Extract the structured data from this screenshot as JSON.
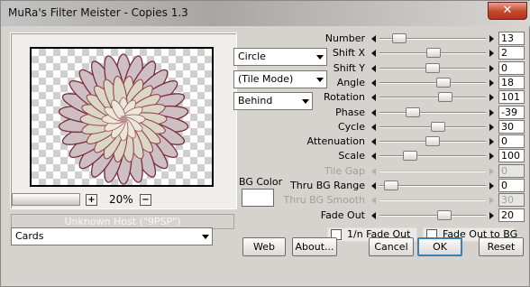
{
  "window": {
    "title": "MuRa's Filter Meister - Copies 1.3",
    "close_glyph": "✕"
  },
  "preview": {
    "zoom_minus": "−",
    "zoom_plus": "+",
    "zoom_level": "20%",
    "host_text": "Unknown Host (\"9PSP\")"
  },
  "combos": {
    "shape": "Circle",
    "tile_mode": "(Tile Mode)",
    "placement": "Behind",
    "preset": "Cards"
  },
  "bg_color": {
    "label": "BG Color",
    "value": "#ffffff"
  },
  "params": [
    {
      "label": "Number",
      "value": "13",
      "level": 0.14,
      "enabled": true
    },
    {
      "label": "Shift X",
      "value": "2",
      "level": 0.51,
      "enabled": true
    },
    {
      "label": "Shift Y",
      "value": "0",
      "level": 0.5,
      "enabled": true
    },
    {
      "label": "Angle",
      "value": "18",
      "level": 0.62,
      "enabled": true
    },
    {
      "label": "Rotation",
      "value": "101",
      "level": 0.64,
      "enabled": true
    },
    {
      "label": "Phase",
      "value": "-39",
      "level": 0.28,
      "enabled": true
    },
    {
      "label": "Cycle",
      "value": "30",
      "level": 0.56,
      "enabled": true
    },
    {
      "label": "Attenuation",
      "value": "0",
      "level": 0.5,
      "enabled": true
    },
    {
      "label": "Scale",
      "value": "100",
      "level": 0.25,
      "enabled": true
    },
    {
      "label": "Tile Gap",
      "value": "0",
      "level": null,
      "enabled": false
    },
    {
      "label": "Thru BG Range",
      "value": "0",
      "level": 0.05,
      "enabled": true
    },
    {
      "label": "Thru BG Smooth",
      "value": "30",
      "level": null,
      "enabled": false
    },
    {
      "label": "Fade Out",
      "value": "20",
      "level": 0.63,
      "enabled": true
    }
  ],
  "checkboxes": {
    "inv_fade": {
      "label": "1/n Fade Out",
      "checked": false
    },
    "fade_bg": {
      "label": "Fade Out to BG",
      "checked": false
    }
  },
  "buttons": {
    "web": "Web",
    "about": "About...",
    "cancel": "Cancel",
    "ok": "OK",
    "reset": "Reset"
  },
  "colors": {
    "dialog_bg": "#d6d3ce",
    "default_button_border": "#3c7fb1",
    "close_button": "#c7442c"
  },
  "icons": {
    "close": "close-icon",
    "combo_arrow": "chevron-down-icon",
    "slider_left": "arrow-left-icon",
    "slider_right": "arrow-right-icon"
  }
}
